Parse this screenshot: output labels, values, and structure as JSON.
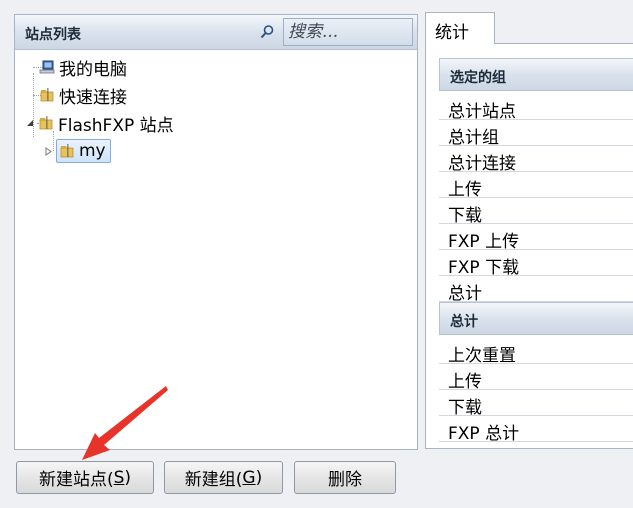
{
  "site_list": {
    "title": "站点列表",
    "search": {
      "placeholder": "搜索..."
    },
    "tree": {
      "my_computer": "我的电脑",
      "quick_connect": "快速连接",
      "flashfxp_sites": "FlashFXP 站点",
      "selected_group": "my"
    }
  },
  "stats": {
    "tab_label": "统计",
    "selected_group_header": "选定的组",
    "selected_group_rows": [
      "总计站点",
      "总计组",
      "总计连接",
      "上传",
      "下载",
      "FXP 上传",
      "FXP 下载",
      "总计"
    ],
    "total_header": "总计",
    "total_rows": [
      "上次重置",
      "上传",
      "下载",
      "FXP 总计"
    ]
  },
  "buttons": {
    "new_site_text": "新建站点(",
    "new_site_key": "S",
    "new_site_close": ")",
    "new_group_text": "新建组(",
    "new_group_key": "G",
    "new_group_close": ")",
    "delete_label": "删除"
  },
  "colors": {
    "annotation_arrow": "#e8332a",
    "folder": "#e9c25a",
    "selection_border": "#84acdd"
  },
  "icons": {
    "search": "magnifier-icon",
    "my_computer": "computer-icon",
    "folder": "folder-icon"
  }
}
